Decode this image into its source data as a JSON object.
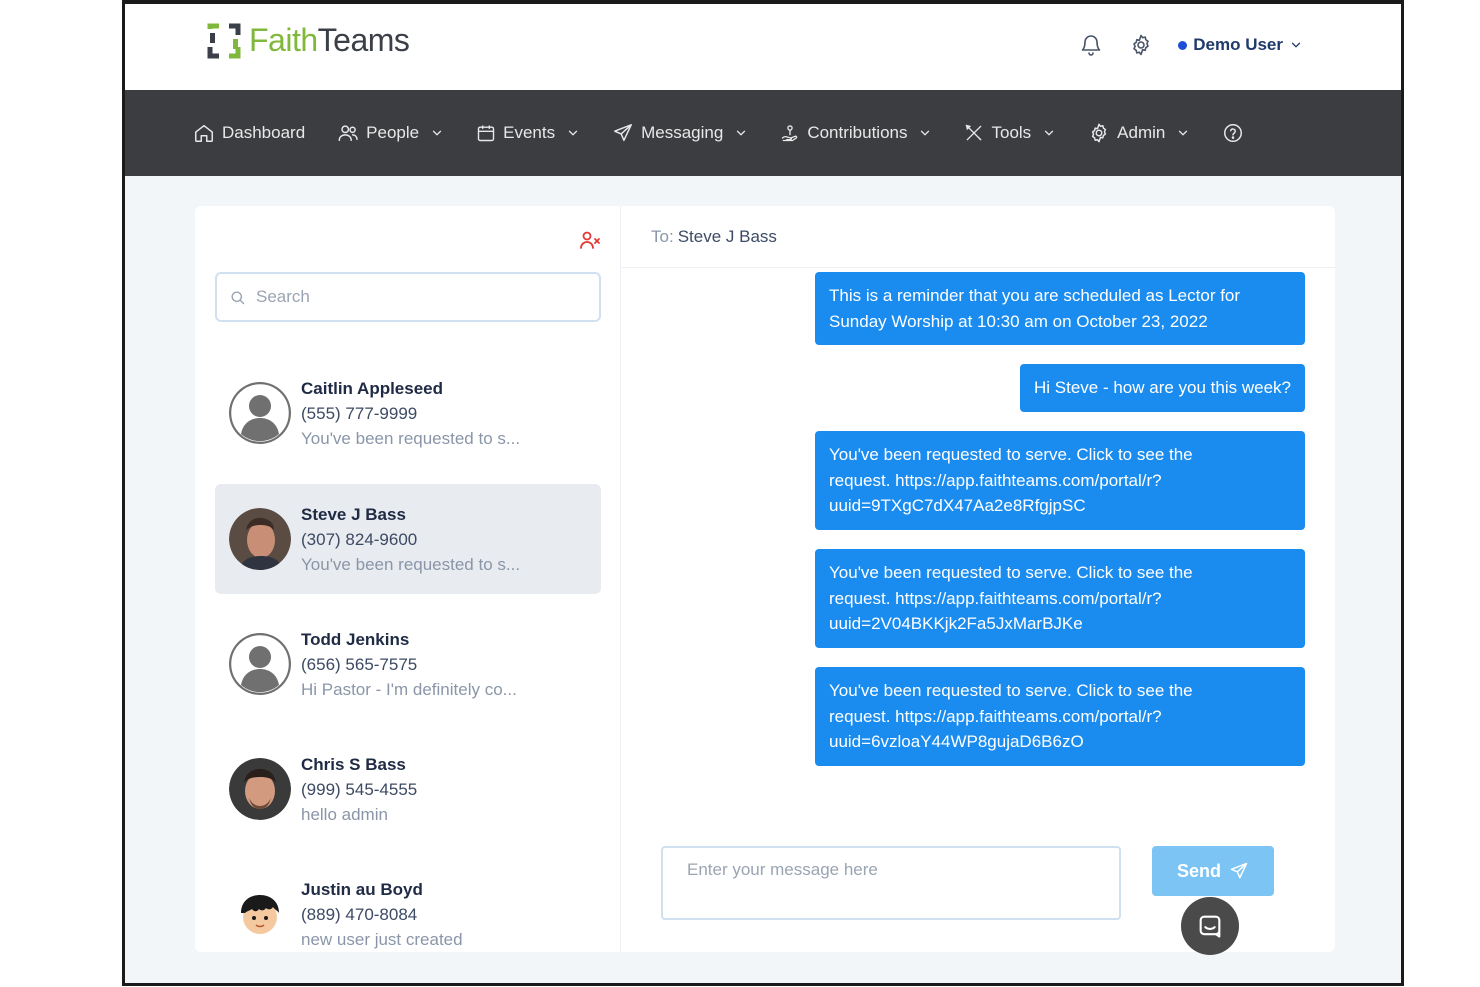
{
  "app": {
    "logo_part1": "Faith",
    "logo_part2": "Teams",
    "user_name": "Demo User"
  },
  "nav": {
    "dashboard": "Dashboard",
    "people": "People",
    "events": "Events",
    "messaging": "Messaging",
    "contributions": "Contributions",
    "tools": "Tools",
    "admin": "Admin"
  },
  "search": {
    "placeholder": "Search"
  },
  "contacts": [
    {
      "name": "Caitlin Appleseed",
      "phone": "(555) 777-9999",
      "preview": "You've been requested to s..."
    },
    {
      "name": "Steve J Bass",
      "phone": "(307) 824-9600",
      "preview": "You've been requested to s..."
    },
    {
      "name": "Todd Jenkins",
      "phone": "(656) 565-7575",
      "preview": "Hi Pastor - I'm definitely co..."
    },
    {
      "name": "Chris S Bass",
      "phone": "(999) 545-4555",
      "preview": "hello admin"
    },
    {
      "name": "Justin au Boyd",
      "phone": "(889) 470-8084",
      "preview": "new user just created"
    }
  ],
  "conversation": {
    "to_label": "To:",
    "to_name": "Steve J Bass",
    "messages": [
      {
        "line1": "This is a reminder that you are scheduled as Lector for",
        "line2": "Sunday Worship at 10:30 am on October 23, 2022"
      },
      {
        "line1": "Hi Steve - how are you this week?"
      },
      {
        "line1": "You've been requested to serve. Click to see the",
        "line2": "request. https://app.faithteams.com/portal/r?",
        "line3": "uuid=9TXgC7dX47Aa2e8RfgjpSC"
      },
      {
        "line1": "You've been requested to serve. Click to see the",
        "line2": "request. https://app.faithteams.com/portal/r?",
        "line3": "uuid=2V04BKKjk2Fa5JxMarBJKe"
      },
      {
        "line1": "You've been requested to serve. Click to see the",
        "line2": "request. https://app.faithteams.com/portal/r?",
        "line3": "uuid=6vzloaY44WP8gujaD6B6zO"
      }
    ]
  },
  "composer": {
    "placeholder": "Enter your message here",
    "send_label": "Send"
  },
  "colors": {
    "brand_green": "#7fb83a",
    "nav_bg": "#3b3d40",
    "bubble_blue": "#1a8cf0",
    "send_disabled": "#7cc4f4"
  }
}
